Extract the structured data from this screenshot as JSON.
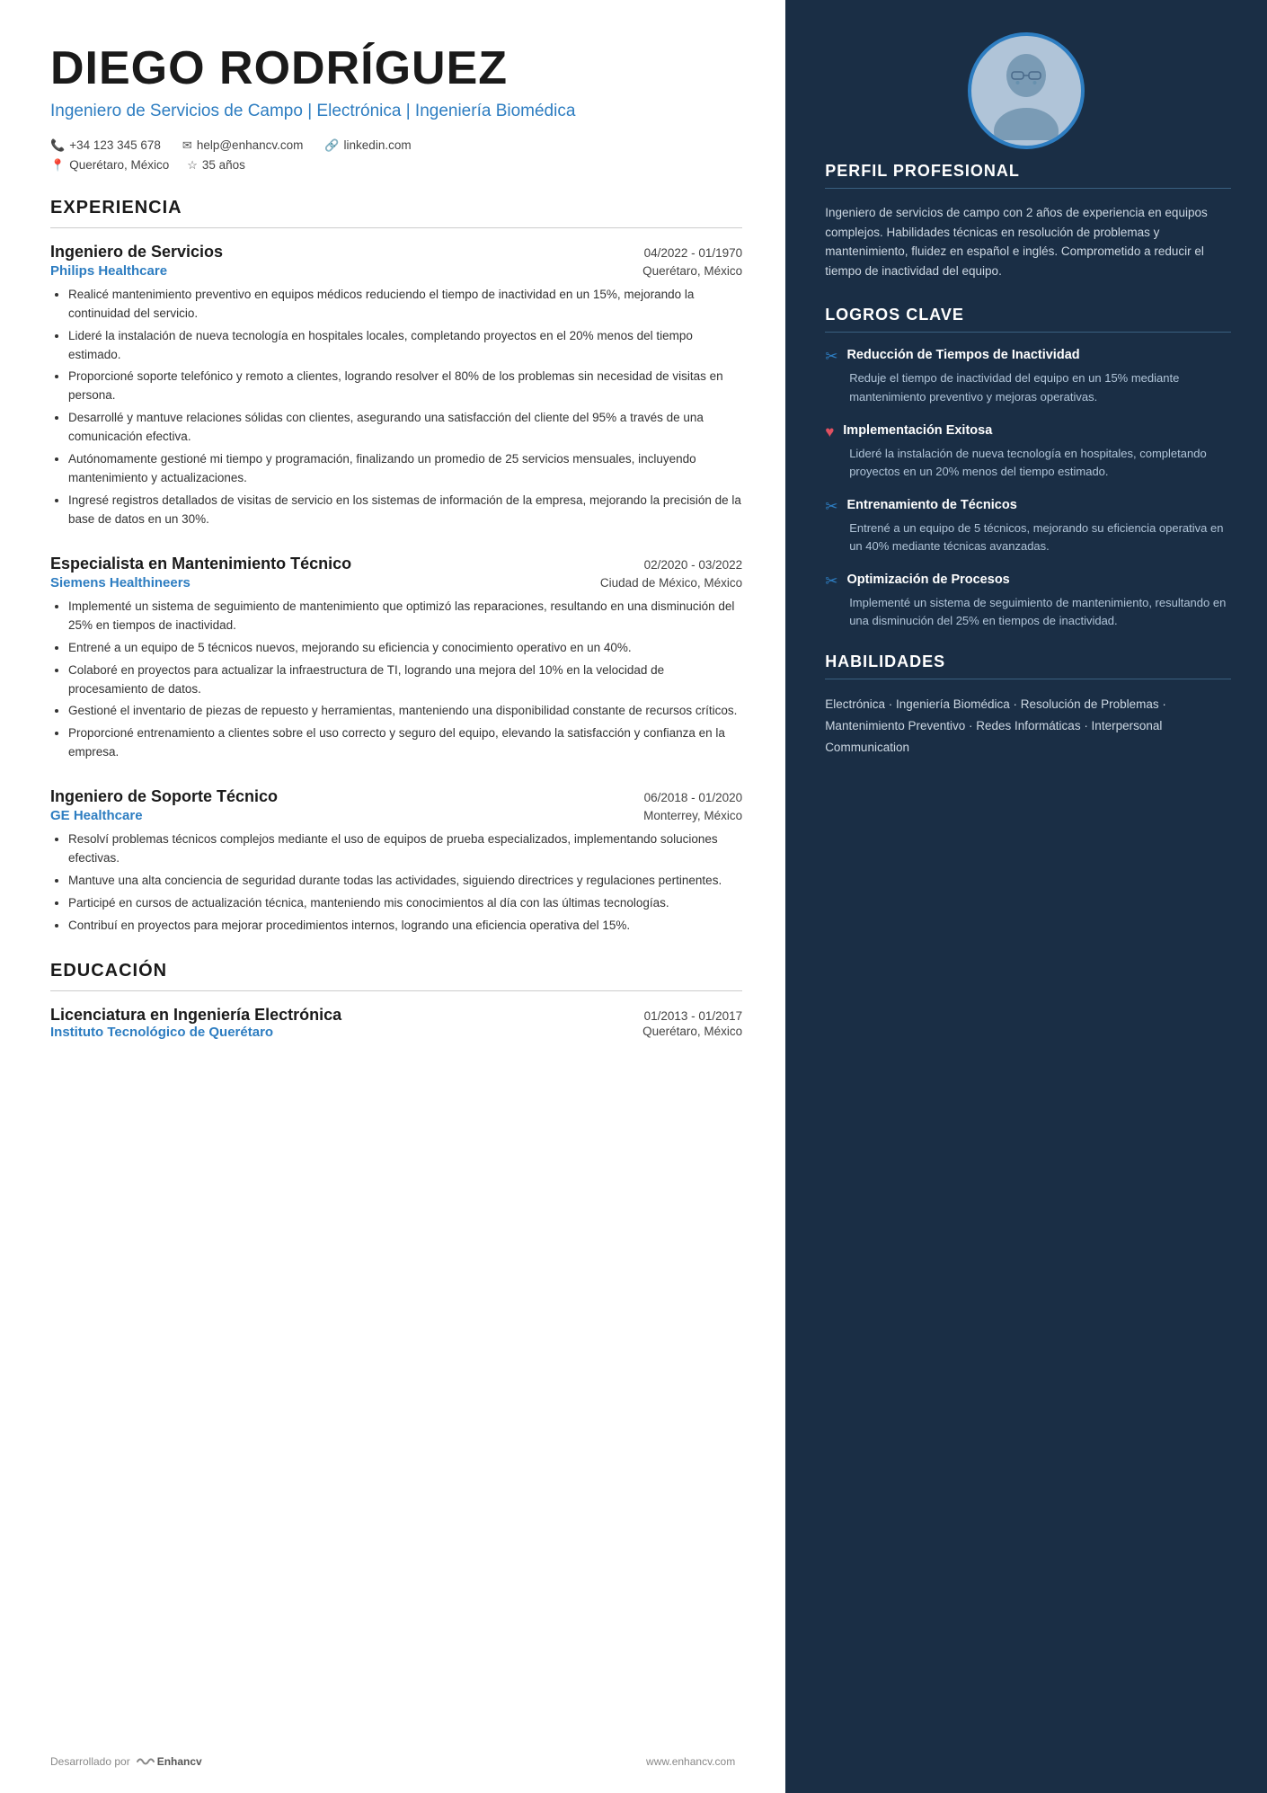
{
  "header": {
    "name": "DIEGO RODRÍGUEZ",
    "title": "Ingeniero de Servicios de Campo | Electrónica | Ingeniería Biomédica",
    "phone": "+34 123 345 678",
    "email": "help@enhancv.com",
    "linkedin": "linkedin.com",
    "location": "Querétaro, México",
    "age": "35 años"
  },
  "sections": {
    "experiencia_label": "EXPERIENCIA",
    "educacion_label": "EDUCACIÓN"
  },
  "experience": [
    {
      "title": "Ingeniero de Servicios",
      "dates": "04/2022 - 01/1970",
      "company": "Philips Healthcare",
      "location": "Querétaro, México",
      "bullets": [
        "Realicé mantenimiento preventivo en equipos médicos reduciendo el tiempo de inactividad en un 15%, mejorando la continuidad del servicio.",
        "Lideré la instalación de nueva tecnología en hospitales locales, completando proyectos en el 20% menos del tiempo estimado.",
        "Proporcioné soporte telefónico y remoto a clientes, logrando resolver el 80% de los problemas sin necesidad de visitas en persona.",
        "Desarrollé y mantuve relaciones sólidas con clientes, asegurando una satisfacción del cliente del 95% a través de una comunicación efectiva.",
        "Autónomamente gestioné mi tiempo y programación, finalizando un promedio de 25 servicios mensuales, incluyendo mantenimiento y actualizaciones.",
        "Ingresé registros detallados de visitas de servicio en los sistemas de información de la empresa, mejorando la precisión de la base de datos en un 30%."
      ]
    },
    {
      "title": "Especialista en Mantenimiento Técnico",
      "dates": "02/2020 - 03/2022",
      "company": "Siemens Healthineers",
      "location": "Ciudad de México, México",
      "bullets": [
        "Implementé un sistema de seguimiento de mantenimiento que optimizó las reparaciones, resultando en una disminución del 25% en tiempos de inactividad.",
        "Entrené a un equipo de 5 técnicos nuevos, mejorando su eficiencia y conocimiento operativo en un 40%.",
        "Colaboré en proyectos para actualizar la infraestructura de TI, logrando una mejora del 10% en la velocidad de procesamiento de datos.",
        "Gestioné el inventario de piezas de repuesto y herramientas, manteniendo una disponibilidad constante de recursos críticos.",
        "Proporcioné entrenamiento a clientes sobre el uso correcto y seguro del equipo, elevando la satisfacción y confianza en la empresa."
      ]
    },
    {
      "title": "Ingeniero de Soporte Técnico",
      "dates": "06/2018 - 01/2020",
      "company": "GE Healthcare",
      "location": "Monterrey, México",
      "bullets": [
        "Resolví problemas técnicos complejos mediante el uso de equipos de prueba especializados, implementando soluciones efectivas.",
        "Mantuve una alta conciencia de seguridad durante todas las actividades, siguiendo directrices y regulaciones pertinentes.",
        "Participé en cursos de actualización técnica, manteniendo mis conocimientos al día con las últimas tecnologías.",
        "Contribuí en proyectos para mejorar procedimientos internos, logrando una eficiencia operativa del 15%."
      ]
    }
  ],
  "education": [
    {
      "title": "Licenciatura en Ingeniería Electrónica",
      "dates": "01/2013 - 01/2017",
      "institution": "Instituto Tecnológico de Querétaro",
      "location": "Querétaro, México"
    }
  ],
  "right": {
    "perfil_label": "PERFIL PROFESIONAL",
    "perfil_text": "Ingeniero de servicios de campo con 2 años de experiencia en equipos complejos. Habilidades técnicas en resolución de problemas y mantenimiento, fluidez en español e inglés. Comprometido a reducir el tiempo de inactividad del equipo.",
    "logros_label": "LOGROS CLAVE",
    "achievements": [
      {
        "icon": "✂",
        "title": "Reducción de Tiempos de Inactividad",
        "desc": "Reduje el tiempo de inactividad del equipo en un 15% mediante mantenimiento preventivo y mejoras operativas."
      },
      {
        "icon": "♥",
        "title": "Implementación Exitosa",
        "desc": "Lideré la instalación de nueva tecnología en hospitales, completando proyectos en un 20% menos del tiempo estimado."
      },
      {
        "icon": "✂",
        "title": "Entrenamiento de Técnicos",
        "desc": "Entrené a un equipo de 5 técnicos, mejorando su eficiencia operativa en un 40% mediante técnicas avanzadas."
      },
      {
        "icon": "✂",
        "title": "Optimización de Procesos",
        "desc": "Implementé un sistema de seguimiento de mantenimiento, resultando en una disminución del 25% en tiempos de inactividad."
      }
    ],
    "habilidades_label": "HABILIDADES",
    "skills": "Electrónica · Ingeniería Biomédica · Resolución de Problemas · Mantenimiento Preventivo · Redes Informáticas · Interpersonal Communication"
  },
  "footer": {
    "desarrollado_label": "Desarrollado por",
    "brand": "Enhancv",
    "website": "www.enhancv.com"
  }
}
